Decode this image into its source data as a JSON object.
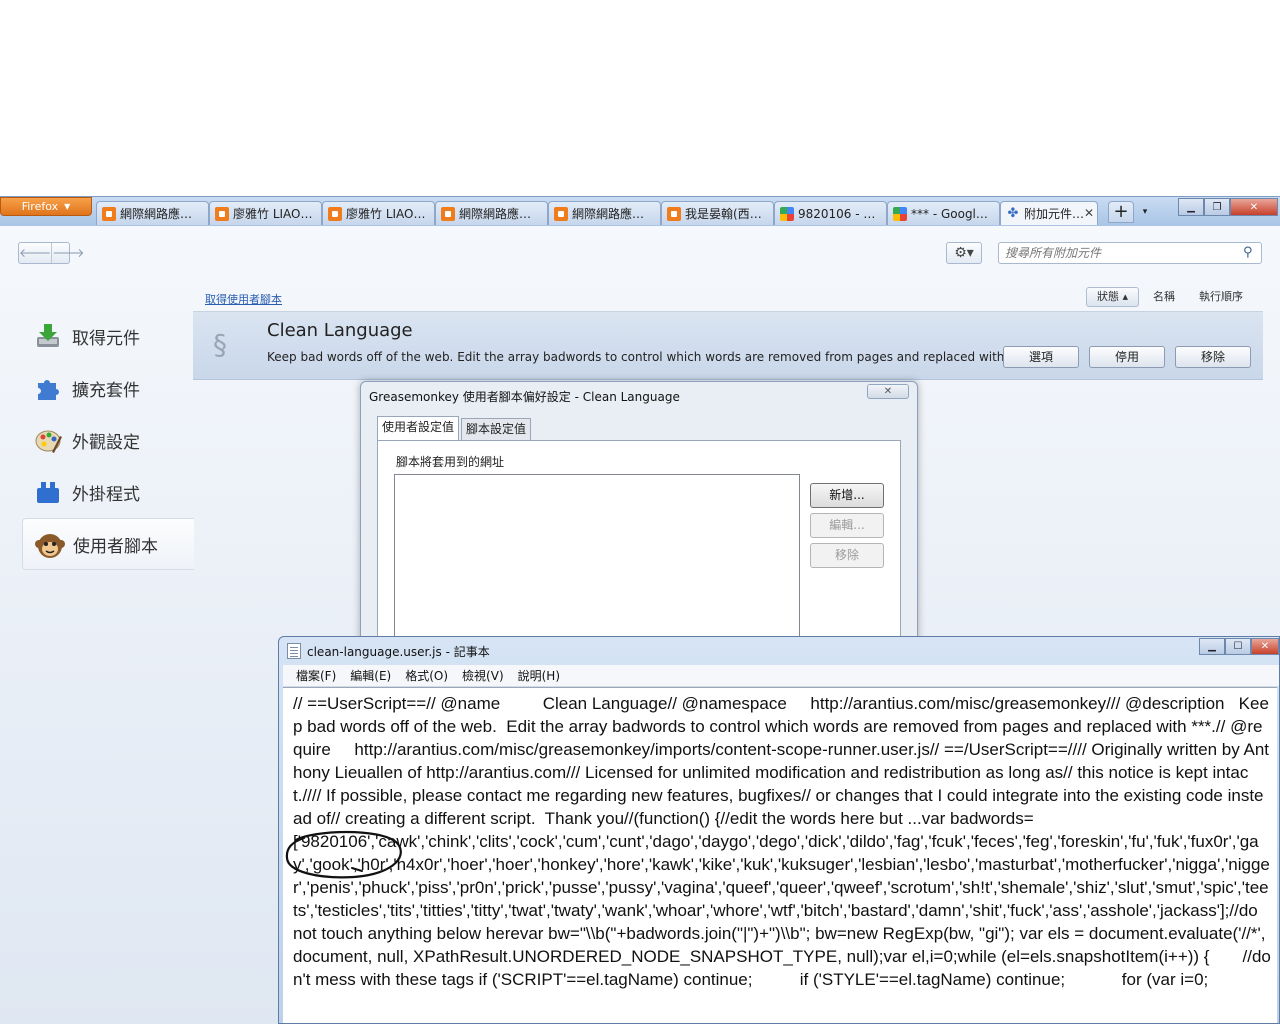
{
  "firefox": {
    "menu_button_label": "Firefox",
    "tabs": [
      {
        "label": "網際網路應用...",
        "favicon": "blogger-icon"
      },
      {
        "label": "廖雅竹 LIAO, ...",
        "favicon": "blogger-icon"
      },
      {
        "label": "廖雅竹 LIAO, ...",
        "favicon": "blogger-icon"
      },
      {
        "label": "網際網路應用...",
        "favicon": "blogger-icon"
      },
      {
        "label": "網際網路應用...",
        "favicon": "blogger-icon"
      },
      {
        "label": "我是晏翰(西瓜...",
        "favicon": "blogger-icon"
      },
      {
        "label": "9820106 - G...",
        "favicon": "google-icon"
      },
      {
        "label": "*** - Google ...",
        "favicon": "google-icon"
      },
      {
        "label": "附加元件管...",
        "favicon": "addon-icon",
        "active": true
      }
    ],
    "new_tab_label": "+",
    "all_tabs_label": "▾"
  },
  "addons": {
    "search_placeholder": "搜尋所有附加元件",
    "categories": [
      {
        "label": "取得元件",
        "icon": "download-icon"
      },
      {
        "label": "擴充套件",
        "icon": "puzzle-icon"
      },
      {
        "label": "外觀設定",
        "icon": "palette-icon"
      },
      {
        "label": "外掛程式",
        "icon": "plugin-icon"
      },
      {
        "label": "使用者腳本",
        "icon": "greasemonkey-icon",
        "selected": true
      }
    ],
    "get_scripts_link": "取得使用者腳本",
    "sort": {
      "status": "狀態",
      "name": "名稱",
      "order": "執行順序"
    },
    "script": {
      "name": "Clean Language",
      "description": "Keep bad words off of the web.  Edit the array badwords to control which words are removed from pages and replaced with ***.",
      "options_label": "選項",
      "disable_label": "停用",
      "remove_label": "移除"
    }
  },
  "gm_dialog": {
    "title": "Greasemonkey 使用者腳本偏好設定 - Clean Language",
    "close_label": "✕",
    "tabs": [
      "使用者設定值",
      "腳本設定值"
    ],
    "urls_label": "腳本將套用到的網址",
    "add_label": "新增...",
    "edit_label": "編輯...",
    "remove_label": "移除"
  },
  "notepad": {
    "title": "clean-language.user.js - 記事本",
    "menus": [
      "檔案(F)",
      "編輯(E)",
      "格式(O)",
      "檢視(V)",
      "說明(H)"
    ],
    "content": "// ==UserScript==// @name         Clean Language// @namespace     http://arantius.com/misc/greasemonkey/// @description   Keep bad words off of the web.  Edit the array badwords to control which words are removed from pages and replaced with ***.// @require     http://arantius.com/misc/greasemonkey/imports/content-scope-runner.user.js// ==/UserScript==//// Originally written by Anthony Lieuallen of http://arantius.com/// Licensed for unlimited modification and redistribution as long as// this notice is kept intact.//// If possible, please contact me regarding new features, bugfixes// or changes that I could integrate into the existing code instead of// creating a different script.  Thank you//(function() {//edit the words here but ...var badwords=\n['9820106','cawk','chink','clits','cock','cum','cunt','dago','daygo','dego','dick','dildo','fag','fcuk','feces','feg','foreskin','fu','fuk','fux0r','gay','gook','h0r','h4x0r','hoer','hoer','honkey','hore','kawk','kike','kuk','kuksuger','lesbian','lesbo','masturbat','motherfucker','nigga','nigger','penis','phuck','piss','pr0n','prick','pusse','pussy','vagina','queef','queer','qweef','scrotum','sh!t','shemale','shiz','slut','smut','spic','teets','testicles','tits','titties','titty','twat','twaty','wank','whoar','whore','wtf','bitch','bastard','damn','shit','fuck','ass','asshole','jackass'];//do not touch anything below herevar bw=\"\\\\b(\"+badwords.join(\"|\")+\")\\\\b\"; bw=new RegExp(bw, \"gi\"); var els = document.evaluate('//*', document, null, XPathResult.UNORDERED_NODE_SNAPSHOT_TYPE, null);var el,i=0;while (el=els.snapshotItem(i++)) {       //don't mess with these tags if ('SCRIPT'==el.tagName) continue;          if ('STYLE'==el.tagName) continue;            for (var i=0;"
  },
  "colors": {
    "firefox_orange": "#e0741c",
    "tab_bar": "#a9c4e6",
    "selected_item": "#c9d7ea",
    "link": "#2a5db0"
  }
}
